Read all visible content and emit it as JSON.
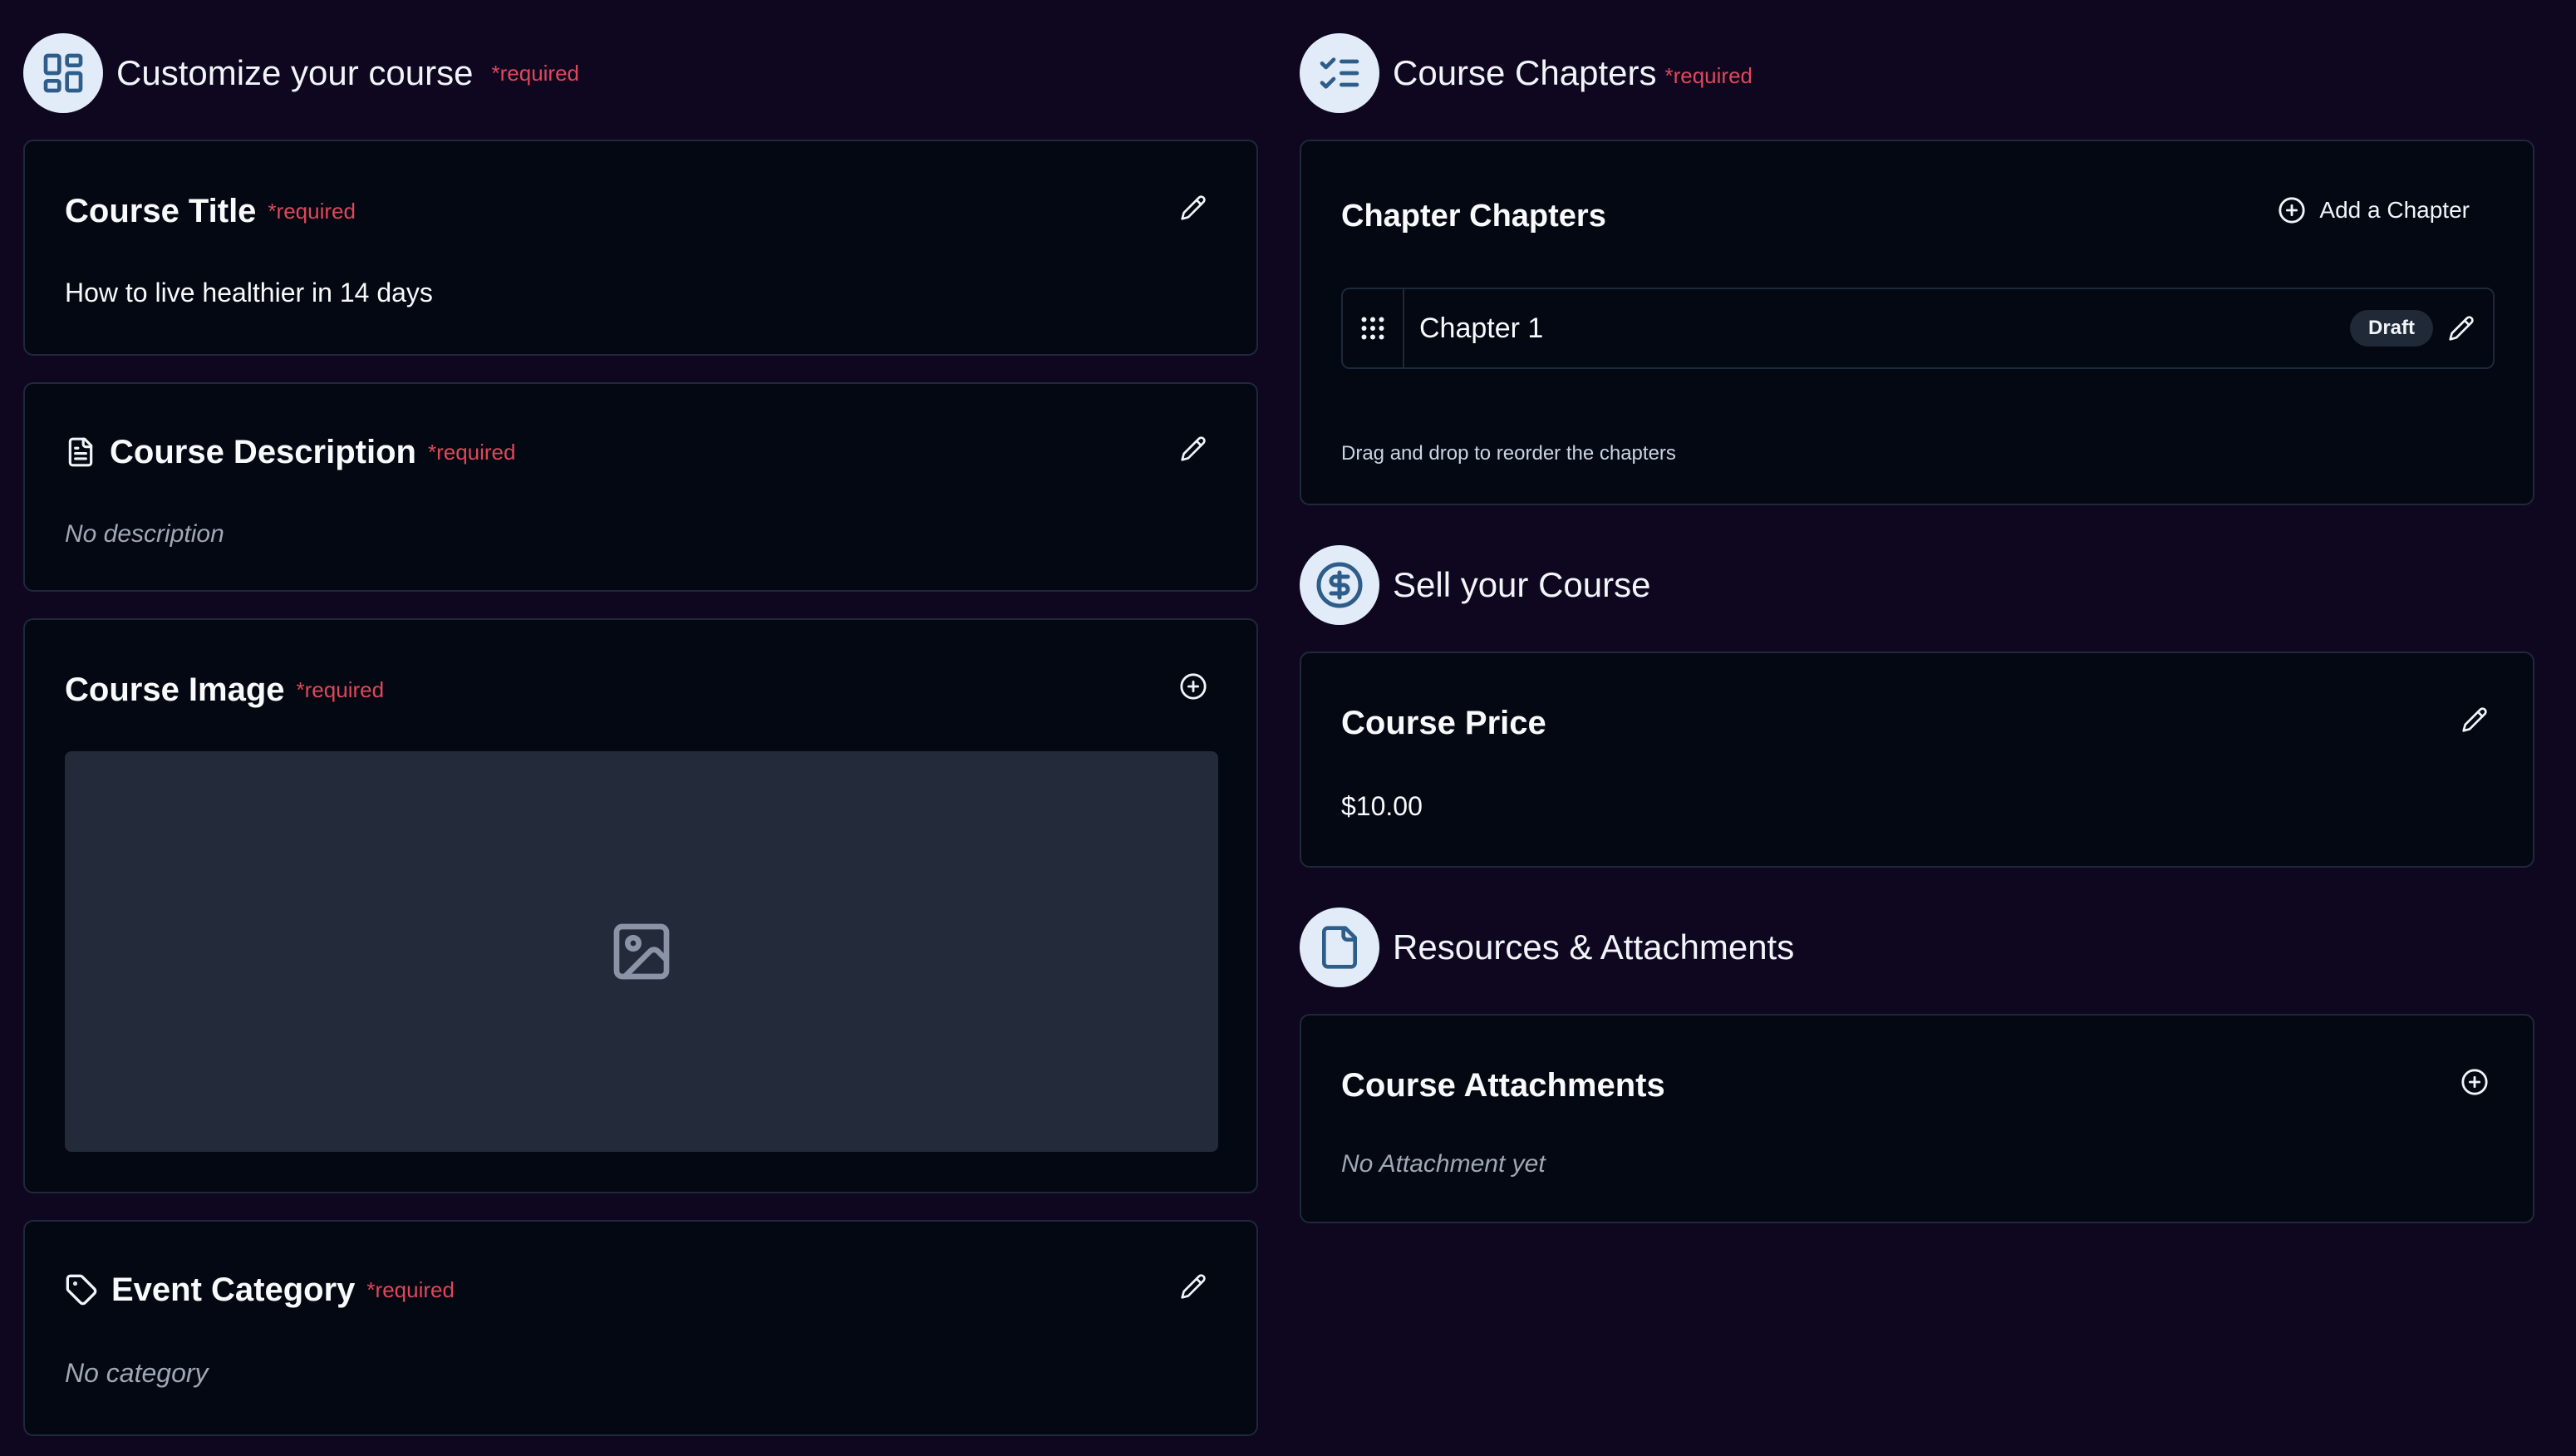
{
  "customize": {
    "title": "Customize your course",
    "required": "*required",
    "icon": "layout-dashboard-icon"
  },
  "course_title": {
    "label": "Course Title",
    "required": "*required",
    "value": "How to live healthier in 14 days"
  },
  "course_description": {
    "label": "Course Description",
    "required": "*required",
    "empty": "No description"
  },
  "course_image": {
    "label": "Course Image",
    "required": "*required"
  },
  "event_category": {
    "label": "Event Category",
    "required": "*required",
    "empty": "No category"
  },
  "chapters_section": {
    "title": "Course Chapters",
    "required": "*required",
    "icon": "list-checks-icon"
  },
  "chapters_card": {
    "label": "Chapter Chapters",
    "add_label": "Add a Chapter",
    "hint": "Drag and drop to reorder the chapters",
    "items": [
      {
        "name": "Chapter 1",
        "status": "Draft"
      }
    ]
  },
  "sell_section": {
    "title": "Sell your Course",
    "icon": "circle-dollar-icon"
  },
  "course_price": {
    "label": "Course Price",
    "value": "$10.00"
  },
  "resources_section": {
    "title": "Resources & Attachments",
    "icon": "file-icon"
  },
  "attachments": {
    "label": "Course Attachments",
    "empty": "No Attachment yet"
  },
  "colors": {
    "background": "#0f0720",
    "card": "#030812",
    "border": "#1e293b",
    "required": "#e0475a",
    "icon_circle": "#e2ecf8",
    "icon_blue": "#2f5d8a",
    "image_placeholder": "#232b3a"
  }
}
